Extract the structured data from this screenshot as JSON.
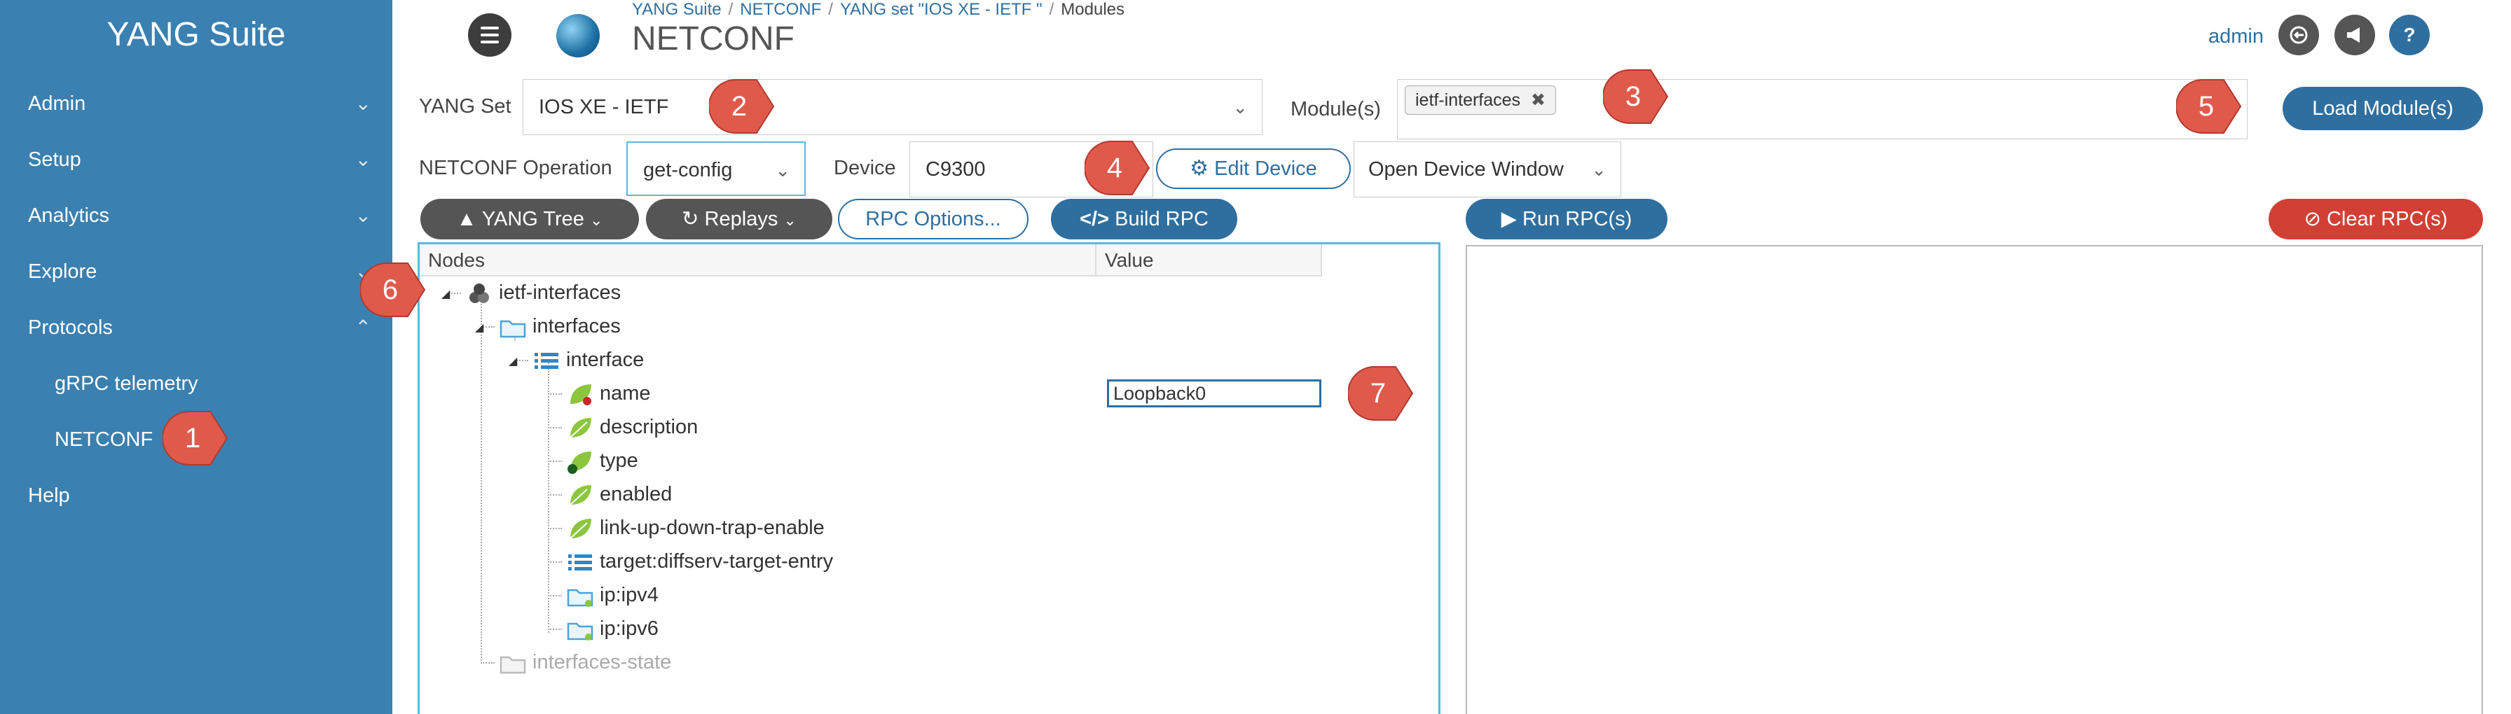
{
  "sidebar": {
    "brand": "YANG Suite",
    "items": [
      {
        "label": "Admin"
      },
      {
        "label": "Setup"
      },
      {
        "label": "Analytics"
      },
      {
        "label": "Explore"
      },
      {
        "label": "Protocols"
      },
      {
        "label": "gRPC telemetry"
      },
      {
        "label": "NETCONF"
      },
      {
        "label": "Help"
      }
    ]
  },
  "header": {
    "breadcrumb": [
      "YANG Suite",
      "NETCONF",
      "YANG set \"IOS XE - IETF \"",
      "Modules"
    ],
    "title": "NETCONF",
    "user": "admin"
  },
  "form": {
    "yang_set_label": "YANG Set",
    "yang_set_value": "IOS XE - IETF",
    "modules_label": "Module(s)",
    "module_tag": "ietf-interfaces",
    "tag_remove": "✖",
    "load_modules": "Load Module(s)",
    "operation_label": "NETCONF Operation",
    "operation_value": "get-config",
    "device_label": "Device",
    "device_value": "C9300",
    "edit_device": "Edit Device",
    "open_device_window": "Open Device Window"
  },
  "toolbar": {
    "yang_tree": "YANG Tree",
    "replays": "Replays",
    "rpc_options": "RPC Options...",
    "build_rpc": "Build RPC",
    "run_rpcs": "Run RPC(s)",
    "clear_rpcs": "Clear RPC(s)"
  },
  "tree": {
    "col_nodes": "Nodes",
    "col_value": "Value",
    "nodes": [
      {
        "label": "ietf-interfaces",
        "icon": "module-icon"
      },
      {
        "label": "interfaces",
        "icon": "folder-open-icon"
      },
      {
        "label": "interface",
        "icon": "list-icon"
      },
      {
        "label": "name",
        "icon": "leaf-key-icon"
      },
      {
        "label": "description",
        "icon": "leaf-icon"
      },
      {
        "label": "type",
        "icon": "leaf-mandatory-icon"
      },
      {
        "label": "enabled",
        "icon": "leaf-icon"
      },
      {
        "label": "link-up-down-trap-enable",
        "icon": "leaf-icon"
      },
      {
        "label": "target:diffserv-target-entry",
        "icon": "list-icon"
      },
      {
        "label": "ip:ipv4",
        "icon": "folder-open-icon"
      },
      {
        "label": "ip:ipv6",
        "icon": "folder-open-icon"
      },
      {
        "label": "interfaces-state",
        "icon": "folder-open-icon"
      }
    ],
    "name_value": "Loopback0"
  },
  "callouts": [
    "1",
    "2",
    "3",
    "4",
    "5",
    "6",
    "7"
  ],
  "colors": {
    "sidebar": "#3a80b0",
    "primary": "#2f6f9f",
    "danger": "#d23f34",
    "callout": "#e05a4b",
    "panel_border": "#5bb8de"
  }
}
